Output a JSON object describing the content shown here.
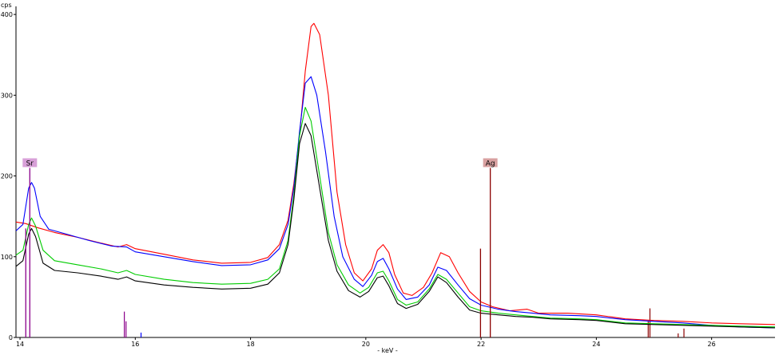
{
  "chart_data": {
    "type": "line",
    "title": "",
    "ylabel": "cps",
    "xlabel": "- keV -",
    "xlim": [
      13.93,
      27.1
    ],
    "ylim": [
      0,
      410
    ],
    "x_ticks": [
      14,
      16,
      18,
      20,
      22,
      24,
      26
    ],
    "y_ticks": [
      0,
      100,
      200,
      300,
      400
    ],
    "grid": false,
    "legend": "none",
    "series": [
      {
        "color": "#ff0000",
        "points": [
          [
            13.93,
            143
          ],
          [
            14.1,
            141
          ],
          [
            14.3,
            136
          ],
          [
            14.6,
            130
          ],
          [
            15.0,
            124
          ],
          [
            15.4,
            117
          ],
          [
            15.7,
            112
          ],
          [
            15.85,
            115
          ],
          [
            16.0,
            110
          ],
          [
            16.5,
            103
          ],
          [
            17.0,
            96
          ],
          [
            17.5,
            92
          ],
          [
            18.0,
            93
          ],
          [
            18.3,
            99
          ],
          [
            18.5,
            115
          ],
          [
            18.65,
            145
          ],
          [
            18.75,
            190
          ],
          [
            18.85,
            250
          ],
          [
            18.95,
            330
          ],
          [
            19.05,
            385
          ],
          [
            19.1,
            389
          ],
          [
            19.2,
            375
          ],
          [
            19.35,
            300
          ],
          [
            19.5,
            180
          ],
          [
            19.65,
            115
          ],
          [
            19.8,
            80
          ],
          [
            19.95,
            70
          ],
          [
            20.1,
            85
          ],
          [
            20.2,
            108
          ],
          [
            20.3,
            115
          ],
          [
            20.4,
            105
          ],
          [
            20.5,
            78
          ],
          [
            20.65,
            55
          ],
          [
            20.8,
            52
          ],
          [
            21.0,
            62
          ],
          [
            21.15,
            80
          ],
          [
            21.3,
            105
          ],
          [
            21.45,
            100
          ],
          [
            21.6,
            80
          ],
          [
            21.8,
            57
          ],
          [
            22.0,
            44
          ],
          [
            22.2,
            38
          ],
          [
            22.5,
            33
          ],
          [
            22.8,
            35
          ],
          [
            23.0,
            30
          ],
          [
            23.5,
            30
          ],
          [
            24.0,
            28
          ],
          [
            24.5,
            23
          ],
          [
            25.0,
            21
          ],
          [
            25.5,
            20
          ],
          [
            26.0,
            18
          ],
          [
            26.5,
            17
          ],
          [
            27.1,
            16
          ]
        ]
      },
      {
        "color": "#0000ff",
        "points": [
          [
            13.93,
            132
          ],
          [
            14.05,
            140
          ],
          [
            14.15,
            185
          ],
          [
            14.2,
            192
          ],
          [
            14.25,
            185
          ],
          [
            14.35,
            150
          ],
          [
            14.5,
            134
          ],
          [
            14.8,
            128
          ],
          [
            15.2,
            120
          ],
          [
            15.6,
            113
          ],
          [
            15.85,
            112
          ],
          [
            16.0,
            106
          ],
          [
            16.5,
            100
          ],
          [
            17.0,
            94
          ],
          [
            17.5,
            89
          ],
          [
            18.0,
            90
          ],
          [
            18.3,
            96
          ],
          [
            18.5,
            110
          ],
          [
            18.65,
            140
          ],
          [
            18.75,
            185
          ],
          [
            18.85,
            255
          ],
          [
            18.95,
            315
          ],
          [
            19.05,
            323
          ],
          [
            19.15,
            300
          ],
          [
            19.3,
            230
          ],
          [
            19.45,
            150
          ],
          [
            19.6,
            100
          ],
          [
            19.8,
            72
          ],
          [
            19.95,
            63
          ],
          [
            20.1,
            77
          ],
          [
            20.2,
            94
          ],
          [
            20.3,
            98
          ],
          [
            20.4,
            85
          ],
          [
            20.55,
            60
          ],
          [
            20.7,
            47
          ],
          [
            20.9,
            50
          ],
          [
            21.1,
            65
          ],
          [
            21.25,
            87
          ],
          [
            21.4,
            83
          ],
          [
            21.6,
            65
          ],
          [
            21.8,
            48
          ],
          [
            22.0,
            40
          ],
          [
            22.3,
            35
          ],
          [
            22.6,
            32
          ],
          [
            22.9,
            30
          ],
          [
            23.2,
            28
          ],
          [
            23.7,
            27
          ],
          [
            24.0,
            26
          ],
          [
            24.5,
            22
          ],
          [
            25.0,
            20
          ],
          [
            25.5,
            18
          ],
          [
            26.0,
            15
          ],
          [
            26.5,
            13
          ],
          [
            27.1,
            12
          ]
        ]
      },
      {
        "color": "#00cc00",
        "points": [
          [
            13.93,
            102
          ],
          [
            14.05,
            108
          ],
          [
            14.15,
            140
          ],
          [
            14.2,
            148
          ],
          [
            14.27,
            138
          ],
          [
            14.4,
            108
          ],
          [
            14.6,
            95
          ],
          [
            15.0,
            90
          ],
          [
            15.4,
            85
          ],
          [
            15.7,
            80
          ],
          [
            15.85,
            83
          ],
          [
            16.0,
            78
          ],
          [
            16.5,
            72
          ],
          [
            17.0,
            68
          ],
          [
            17.5,
            66
          ],
          [
            18.0,
            67
          ],
          [
            18.3,
            72
          ],
          [
            18.5,
            85
          ],
          [
            18.65,
            120
          ],
          [
            18.75,
            175
          ],
          [
            18.85,
            250
          ],
          [
            18.95,
            285
          ],
          [
            19.05,
            268
          ],
          [
            19.2,
            200
          ],
          [
            19.35,
            130
          ],
          [
            19.5,
            90
          ],
          [
            19.7,
            65
          ],
          [
            19.9,
            55
          ],
          [
            20.05,
            62
          ],
          [
            20.2,
            80
          ],
          [
            20.3,
            82
          ],
          [
            20.4,
            70
          ],
          [
            20.55,
            47
          ],
          [
            20.7,
            40
          ],
          [
            20.9,
            44
          ],
          [
            21.1,
            60
          ],
          [
            21.25,
            78
          ],
          [
            21.4,
            72
          ],
          [
            21.6,
            55
          ],
          [
            21.8,
            38
          ],
          [
            22.0,
            33
          ],
          [
            22.3,
            30
          ],
          [
            22.6,
            28
          ],
          [
            22.9,
            26
          ],
          [
            23.2,
            24
          ],
          [
            23.7,
            23
          ],
          [
            24.0,
            22
          ],
          [
            24.5,
            18
          ],
          [
            25.0,
            17
          ],
          [
            25.5,
            16
          ],
          [
            26.0,
            15
          ],
          [
            26.5,
            14
          ],
          [
            27.1,
            13
          ]
        ]
      },
      {
        "color": "#000000",
        "points": [
          [
            13.93,
            88
          ],
          [
            14.05,
            95
          ],
          [
            14.15,
            128
          ],
          [
            14.2,
            135
          ],
          [
            14.27,
            125
          ],
          [
            14.4,
            92
          ],
          [
            14.6,
            83
          ],
          [
            15.0,
            80
          ],
          [
            15.4,
            76
          ],
          [
            15.7,
            72
          ],
          [
            15.85,
            75
          ],
          [
            16.0,
            70
          ],
          [
            16.5,
            65
          ],
          [
            17.0,
            62
          ],
          [
            17.5,
            60
          ],
          [
            18.0,
            61
          ],
          [
            18.3,
            66
          ],
          [
            18.5,
            80
          ],
          [
            18.65,
            115
          ],
          [
            18.75,
            170
          ],
          [
            18.85,
            240
          ],
          [
            18.95,
            265
          ],
          [
            19.05,
            250
          ],
          [
            19.2,
            185
          ],
          [
            19.35,
            120
          ],
          [
            19.5,
            82
          ],
          [
            19.7,
            58
          ],
          [
            19.9,
            50
          ],
          [
            20.05,
            57
          ],
          [
            20.2,
            74
          ],
          [
            20.3,
            76
          ],
          [
            20.4,
            64
          ],
          [
            20.55,
            42
          ],
          [
            20.7,
            36
          ],
          [
            20.9,
            41
          ],
          [
            21.1,
            57
          ],
          [
            21.25,
            75
          ],
          [
            21.4,
            68
          ],
          [
            21.6,
            50
          ],
          [
            21.8,
            34
          ],
          [
            22.0,
            30
          ],
          [
            22.3,
            28
          ],
          [
            22.6,
            26
          ],
          [
            22.9,
            25
          ],
          [
            23.2,
            23
          ],
          [
            23.7,
            22
          ],
          [
            24.0,
            21
          ],
          [
            24.5,
            17
          ],
          [
            25.0,
            16
          ],
          [
            25.5,
            15
          ],
          [
            26.0,
            14
          ],
          [
            26.5,
            13
          ],
          [
            27.1,
            12
          ]
        ]
      }
    ],
    "element_markers": [
      {
        "label": "Sr",
        "x": 14.17,
        "y": 210,
        "color": "#8b008b",
        "box_color": "#d8a0d8",
        "lines": [
          {
            "x": 14.1,
            "height": 135
          },
          {
            "x": 14.17,
            "height": 210
          }
        ]
      },
      {
        "label": "Ag",
        "x": 22.16,
        "y": 210,
        "color": "#8b0000",
        "box_color": "#d8a0a0",
        "lines": [
          {
            "x": 21.99,
            "height": 110
          },
          {
            "x": 22.16,
            "height": 210
          }
        ]
      }
    ],
    "minor_lines": [
      {
        "x": 15.81,
        "height": 32,
        "color": "#8b008b"
      },
      {
        "x": 15.84,
        "height": 20,
        "color": "#8b008b"
      },
      {
        "x": 16.1,
        "height": 6,
        "color": "#0000ff"
      },
      {
        "x": 24.93,
        "height": 36,
        "color": "#8b0000"
      },
      {
        "x": 24.9,
        "height": 20,
        "color": "#8b0000"
      },
      {
        "x": 25.52,
        "height": 11,
        "color": "#8b0000"
      },
      {
        "x": 25.42,
        "height": 5,
        "color": "#8b0000"
      }
    ]
  }
}
